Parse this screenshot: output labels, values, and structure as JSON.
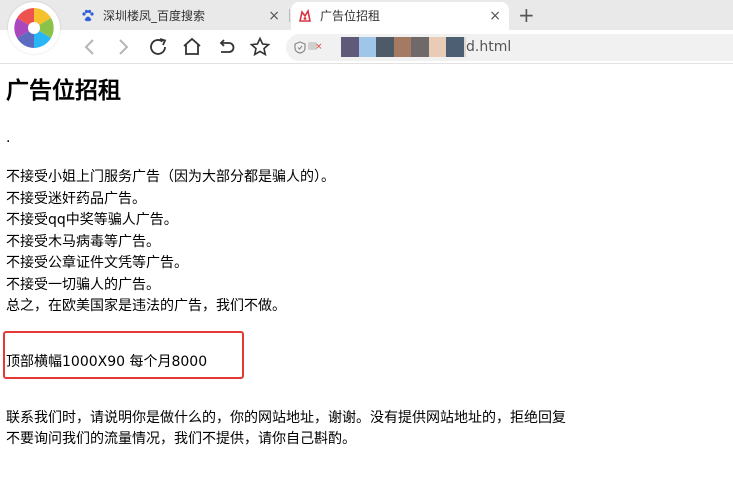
{
  "browser": {
    "tabs": [
      {
        "title": "深圳楼凤_百度搜索",
        "close": "×"
      },
      {
        "title": "广告位招租",
        "close": "×"
      }
    ],
    "new_tab": "+",
    "address_tail": "d.html"
  },
  "page": {
    "heading": "广告位招租",
    "dot": ".",
    "rules": [
      "不接受小姐上门服务广告（因为大部分都是骗人的）。",
      "不接受迷奸药品广告。",
      "不接受qq中奖等骗人广告。",
      "不接受木马病毒等广告。",
      "不接受公章证件文凭等广告。",
      "不接受一切骗人的广告。",
      "总之，在欧美国家是违法的广告，我们不做。"
    ],
    "offer": "顶部横幅1000X90 每个月8000",
    "contact": [
      "联系我们时，请说明你是做什么的，你的网站地址，谢谢。没有提供网站地址的，拒绝回复",
      "不要询问我们的流量情况，我们不提供，请你自己斟酌。"
    ]
  },
  "colors": {
    "tabstrip": "#e9e9ea",
    "address_bar": "#f1f1f2",
    "highlight_border": "#e53935"
  }
}
